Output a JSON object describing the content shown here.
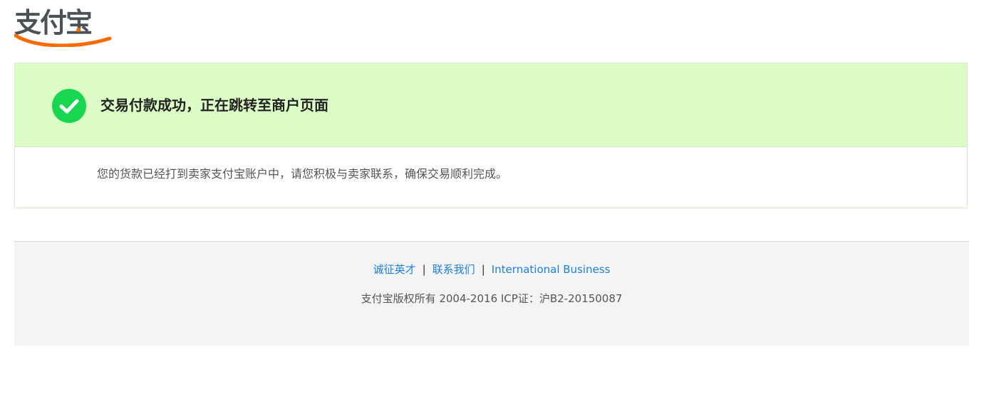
{
  "logo": {
    "text": "支付宝",
    "brand_color": "#ff6a00"
  },
  "result": {
    "status_icon": "check-circle-icon",
    "status_color": "#17d64f",
    "title": "交易付款成功，正在跳转至商户页面",
    "description": "您的货款已经打到卖家支付宝账户中，请您积极与卖家联系，确保交易顺利完成。"
  },
  "footer": {
    "links": [
      {
        "label": "诚征英才"
      },
      {
        "label": "联系我们"
      },
      {
        "label": "International Business"
      }
    ],
    "separator": "|",
    "copyright": "支付宝版权所有 2004-2016 ICP证：沪B2-20150087"
  }
}
